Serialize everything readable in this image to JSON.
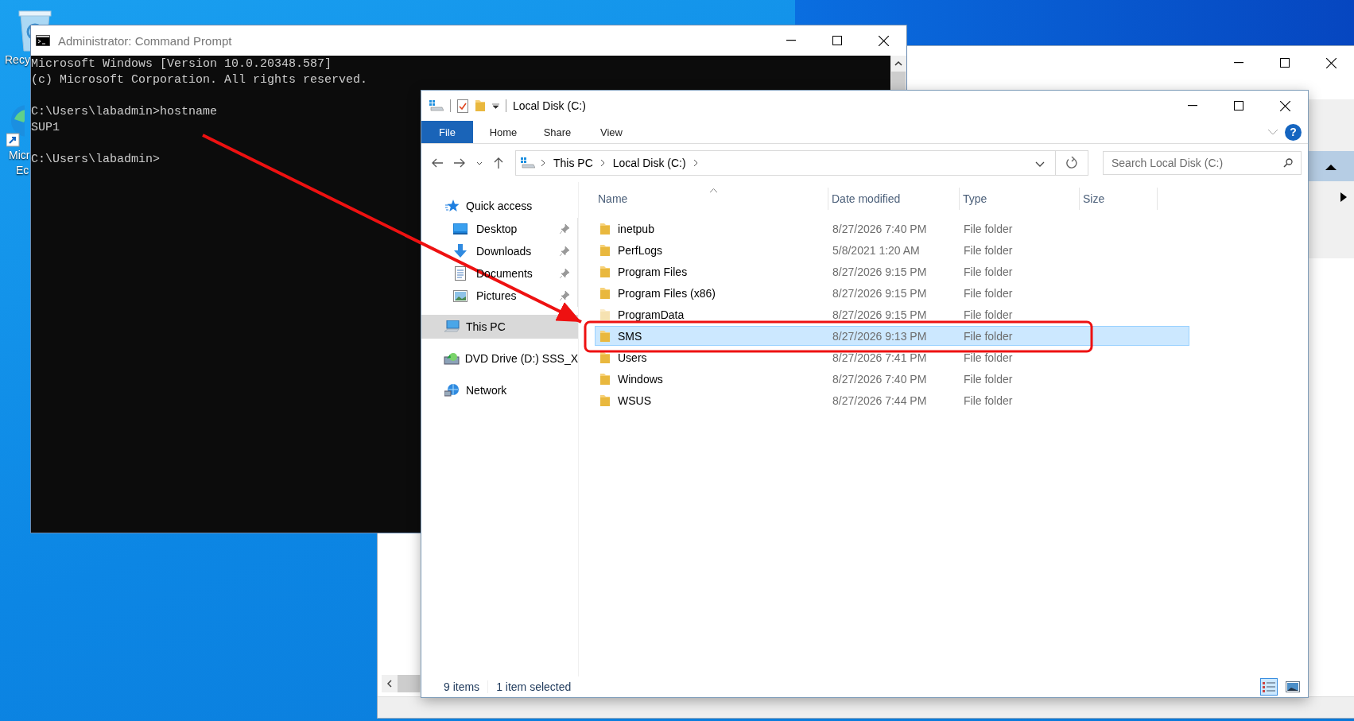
{
  "desktop": {
    "icons": [
      {
        "kind": "recycle",
        "lines": [
          "Recy"
        ]
      },
      {
        "kind": "browser",
        "lines": [
          "Micr",
          "Ec"
        ]
      }
    ]
  },
  "cmd_window": {
    "title": "Administrator: Command Prompt",
    "blocks": [
      [
        "Microsoft Windows [Version 10.0.20348.587]",
        "(c) Microsoft Corporation. All rights reserved."
      ],
      [
        "C:\\Users\\labadmin>hostname",
        "SUP1"
      ],
      [
        "C:\\Users\\labadmin>"
      ]
    ]
  },
  "explorer": {
    "title": "Local Disk (C:)",
    "ribbon_tabs": [
      {
        "label": "File",
        "kind": "file",
        "selected": false
      },
      {
        "label": "Home",
        "kind": "tab",
        "selected": false
      },
      {
        "label": "Share",
        "kind": "tab",
        "selected": false
      },
      {
        "label": "View",
        "kind": "tab",
        "selected": false
      }
    ],
    "help": "?",
    "breadcrumb": [
      "This PC",
      "Local Disk (C:)"
    ],
    "search": {
      "placeholder": "Search Local Disk (C:)"
    },
    "nav": [
      {
        "label": "Quick access",
        "kind": "star",
        "selected": false,
        "children": [
          {
            "label": "Desktop",
            "kind": "desktop",
            "pinned": true,
            "selected": false
          },
          {
            "label": "Downloads",
            "kind": "downloads",
            "pinned": true,
            "selected": false
          },
          {
            "label": "Documents",
            "kind": "documents",
            "pinned": true,
            "selected": false
          },
          {
            "label": "Pictures",
            "kind": "pictures",
            "pinned": true,
            "selected": false
          }
        ]
      },
      {
        "label": "This PC",
        "kind": "pc",
        "selected": true
      },
      {
        "label": "DVD Drive (D:) SSS_X",
        "kind": "dvd",
        "selected": false
      },
      {
        "label": "Network",
        "kind": "network",
        "selected": false
      }
    ],
    "columns": [
      {
        "label": "Name",
        "sorted": true
      },
      {
        "label": "Date modified",
        "sorted": false
      },
      {
        "label": "Type",
        "sorted": false
      },
      {
        "label": "Size",
        "sorted": false
      }
    ],
    "rows": [
      {
        "name": "inetpub",
        "date": "8/27/2026 7:40 PM",
        "type": "File folder",
        "hidden": false,
        "selected": false
      },
      {
        "name": "PerfLogs",
        "date": "5/8/2021 1:20 AM",
        "type": "File folder",
        "hidden": false,
        "selected": false
      },
      {
        "name": "Program Files",
        "date": "8/27/2026 9:15 PM",
        "type": "File folder",
        "hidden": false,
        "selected": false
      },
      {
        "name": "Program Files (x86)",
        "date": "8/27/2026 9:15 PM",
        "type": "File folder",
        "hidden": false,
        "selected": false
      },
      {
        "name": "ProgramData",
        "date": "8/27/2026 9:15 PM",
        "type": "File folder",
        "hidden": true,
        "selected": false
      },
      {
        "name": "SMS",
        "date": "8/27/2026 9:13 PM",
        "type": "File folder",
        "hidden": false,
        "selected": true
      },
      {
        "name": "Users",
        "date": "8/27/2026 7:41 PM",
        "type": "File folder",
        "hidden": false,
        "selected": false
      },
      {
        "name": "Windows",
        "date": "8/27/2026 7:40 PM",
        "type": "File folder",
        "hidden": false,
        "selected": false
      },
      {
        "name": "WSUS",
        "date": "8/27/2026 7:44 PM",
        "type": "File folder",
        "hidden": false,
        "selected": false
      }
    ],
    "status": {
      "count": "9 items",
      "selection": "1 item selected"
    },
    "view_modes": [
      {
        "kind": "details",
        "selected": true
      },
      {
        "kind": "tiles",
        "selected": false
      }
    ]
  }
}
